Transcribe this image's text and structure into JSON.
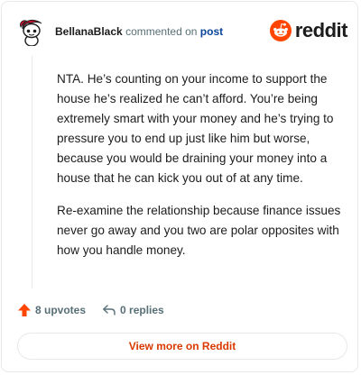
{
  "header": {
    "username": "BellanaBlack",
    "action_text": "commented on",
    "post_link": "post",
    "brand": "reddit"
  },
  "comment": {
    "paragraphs": [
      "NTA. He’s counting on your income to support the house he’s realized he can’t afford. You’re being extremely smart with your money and he’s trying to pressure you to end up just like him but worse, because you would be draining your money into a house that he can kick you out of at any time.",
      "Re-examine the relationship because finance issues never go away and you two are polar opposites with how you handle money."
    ]
  },
  "actions": {
    "upvotes": "8 upvotes",
    "replies": "0 replies"
  },
  "footer": {
    "view_more": "View more on Reddit"
  },
  "colors": {
    "brand_orange": "#ff4500",
    "link_blue": "#0a449b",
    "cta_orange": "#d93900",
    "muted": "#576f76"
  },
  "icons": {
    "avatar": "snoo-avatar-red-hair",
    "logo": "reddit-snoo-logo-icon",
    "upvote": "upvote-arrow-icon",
    "reply": "reply-arrow-icon"
  }
}
